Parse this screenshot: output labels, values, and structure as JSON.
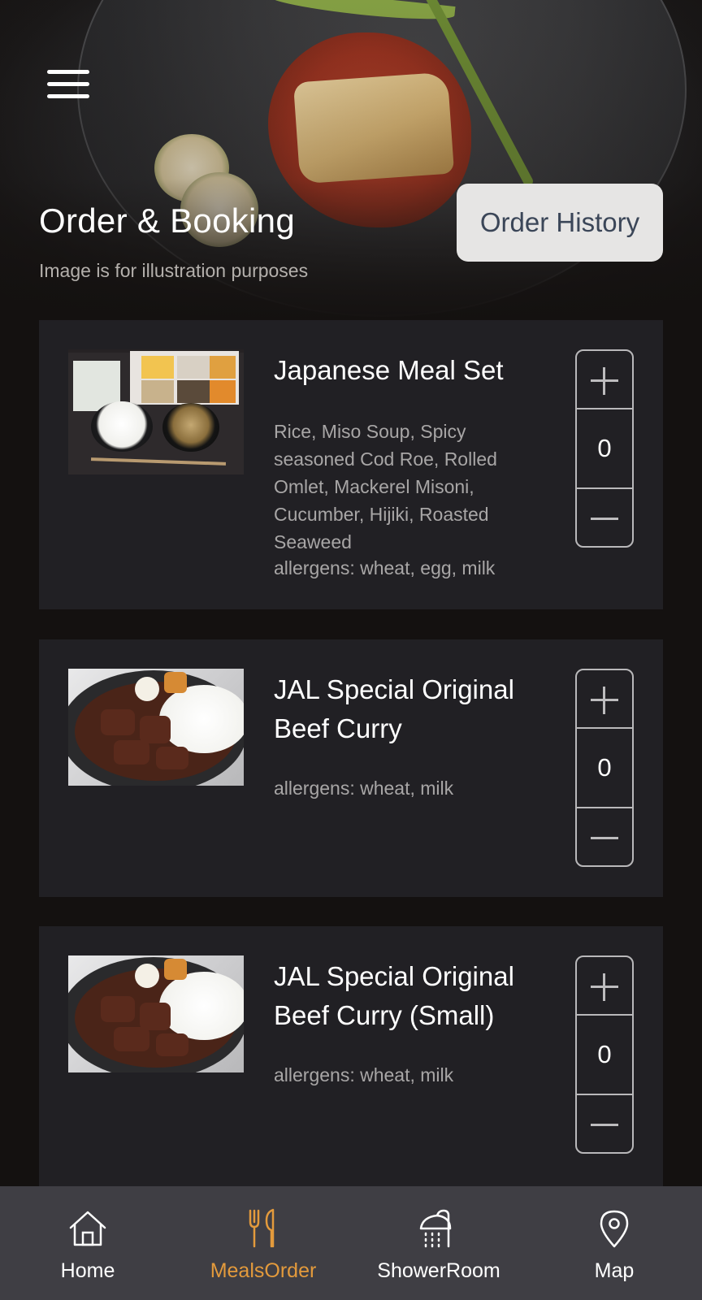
{
  "header": {
    "title": "Order & Booking",
    "subtitle": "Image is for illustration purposes",
    "order_history_label": "Order History"
  },
  "meals": [
    {
      "name": "Japanese Meal Set",
      "description": "Rice, Miso Soup, Spicy seasoned Cod Roe, Rolled Omlet,  Mackerel Misoni, Cucumber, Hijiki, Roasted Seaweed",
      "allergens": "allergens: wheat, egg, milk",
      "quantity": "0",
      "thumbnail": "japanese-meal-set-photo"
    },
    {
      "name": "JAL Special Original Beef Curry",
      "description": "",
      "allergens": "allergens: wheat, milk",
      "quantity": "0",
      "thumbnail": "beef-curry-photo"
    },
    {
      "name": "JAL Special Original Beef Curry (Small)",
      "description": "",
      "allergens": "allergens: wheat, milk",
      "quantity": "0",
      "thumbnail": "beef-curry-photo"
    }
  ],
  "nav": {
    "items": [
      {
        "label": "Home",
        "icon": "home-icon"
      },
      {
        "label": "MealsOrder",
        "icon": "fork-knife-icon",
        "active": true
      },
      {
        "label": "ShowerRoom",
        "icon": "shower-icon"
      },
      {
        "label": "Map",
        "icon": "map-pin-icon"
      }
    ]
  },
  "colors": {
    "background": "#141110",
    "card": "#212024",
    "nav_background": "#3f3e44",
    "accent": "#e39a3c",
    "order_history_bg": "#e6e5e4",
    "order_history_text": "#3b4658"
  }
}
